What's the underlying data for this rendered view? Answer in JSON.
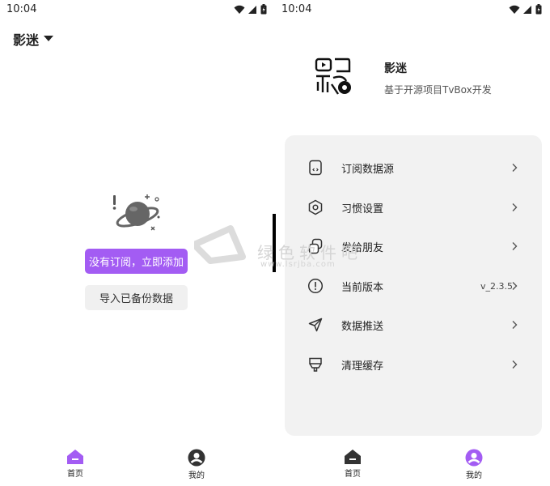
{
  "left": {
    "status_time": "10:04",
    "title": "影迷",
    "subscribe_button": "没有订阅，立即添加",
    "import_button": "导入已备份数据",
    "nav": [
      {
        "label": "首页",
        "active": true
      },
      {
        "label": "我的",
        "active": false
      }
    ]
  },
  "right": {
    "status_time": "10:04",
    "profile": {
      "name": "影迷",
      "description": "基于开源项目TvBox开发"
    },
    "menu": [
      {
        "label": "订阅数据源",
        "icon": "subscription-icon",
        "value": ""
      },
      {
        "label": "习惯设置",
        "icon": "settings-icon",
        "value": ""
      },
      {
        "label": "发给朋友",
        "icon": "share-icon",
        "value": ""
      },
      {
        "label": "当前版本",
        "icon": "info-icon",
        "value": "v_2.3.5"
      },
      {
        "label": "数据推送",
        "icon": "send-icon",
        "value": ""
      },
      {
        "label": "清理缓存",
        "icon": "clean-icon",
        "value": ""
      }
    ],
    "nav": [
      {
        "label": "首页",
        "active": false
      },
      {
        "label": "我的",
        "active": true
      }
    ]
  },
  "watermark": {
    "text": "绿色软件吧",
    "url": "www.lsrjba.com"
  },
  "colors": {
    "accent": "#a35cf3",
    "nav_inactive": "#333333",
    "card_bg": "#f2f2f2"
  }
}
